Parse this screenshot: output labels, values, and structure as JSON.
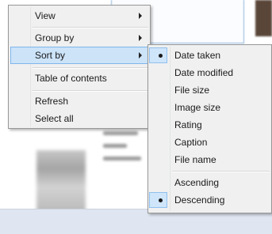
{
  "main_menu": {
    "items": [
      {
        "label": "View",
        "submenu": true
      },
      {
        "label": "Group by",
        "submenu": true
      },
      {
        "label": "Sort by",
        "submenu": true,
        "highlighted": true
      },
      {
        "label": "Table of contents"
      },
      {
        "label": "Refresh"
      },
      {
        "label": "Select all"
      }
    ]
  },
  "sort_menu": {
    "fields": [
      "Date taken",
      "Date modified",
      "File size",
      "Image size",
      "Rating",
      "Caption",
      "File name"
    ],
    "selected_field": "Date taken",
    "orders": [
      "Ascending",
      "Descending"
    ],
    "selected_order": "Descending"
  },
  "colors": {
    "highlight_bg": "#cce3f8",
    "highlight_border": "#7fb6ec",
    "menu_bg": "#f0f0f0"
  }
}
